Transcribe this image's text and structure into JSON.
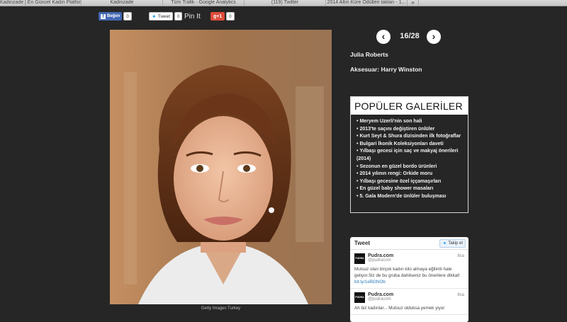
{
  "browser": {
    "tabs": [
      "Kadinzade | En Güncel Kadın Platformu",
      "Kadinzade",
      "Tüm Trafik - Google Analytics",
      "(119) Twitter",
      "2014 Altın Küre Ödülleri takları - 1..."
    ],
    "overflow_label": "»"
  },
  "share": {
    "facebook_label": "Beğen",
    "facebook_count": "0",
    "twitter_label": "Tweet",
    "twitter_count": "0",
    "pin_label": "Pin It",
    "gplus_label": "g+1",
    "gplus_count": "0"
  },
  "gallery": {
    "counter": "16/28",
    "prev_glyph": "‹",
    "next_glyph": "›",
    "celebrity": "Julia Roberts",
    "accessory": "Aksesuar: Harry Winston",
    "photo_credit": "Getty Images Turkey"
  },
  "popular": {
    "title": "POPÜLER GALERİLER",
    "items": [
      "Meryem Uzerli'nin son hali",
      "2013'te saçını değiştiren ünlüler",
      "Kurt Seyt & Shura dizisinden ilk fotoğraflar",
      "Bulgari İkonik Koleksiyonları daveti",
      "Yılbaşı gecesi için saç ve makyaj önerileri (2014)",
      "Sezonun en güzel bordo ürünleri",
      "2014 yılının rengi: Orkide moru",
      "Yılbaşı gecesine özel iççamaşırları",
      "En güzel baby shower masaları",
      "5. Gala Modern'de ünlüler buluşması"
    ]
  },
  "tweets": {
    "title": "Tweet",
    "follow_label": "Takip et",
    "items": [
      {
        "avatar": "PUDRA",
        "name": "Pudra.com",
        "handle": "@pudracom",
        "time": "8sa",
        "text": "Mutsuz olan birçok kadın kilo almaya eğilimli hale geliyor.Siz de bu gruba dahilseniz bu önerilere dikkat!",
        "link": "bit.ly/1eBONOb"
      },
      {
        "avatar": "PUDRA",
        "name": "Pudra.com",
        "handle": "@pudracom",
        "time": "8sa",
        "text": "Ah biz kadınlar... Mutsuz olduksa yemek yiyor",
        "link": ""
      }
    ]
  },
  "colors": {
    "page_bg": "#262626",
    "facebook": "#4267b2",
    "twitter": "#1da1f2",
    "gplus": "#dd4b39"
  }
}
